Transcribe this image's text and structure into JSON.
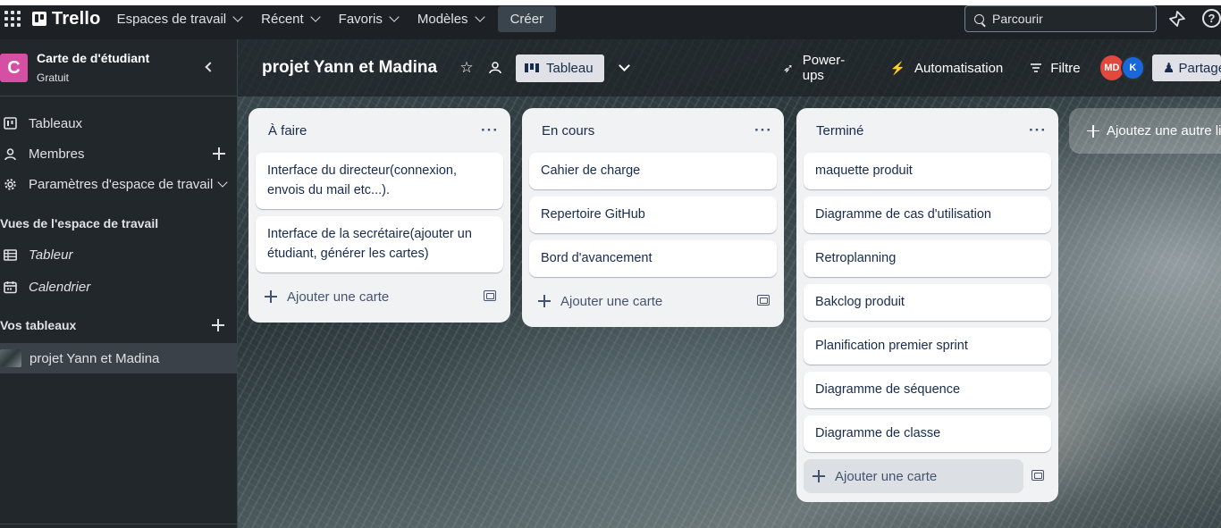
{
  "header": {
    "app_name": "Trello",
    "nav": [
      {
        "label": "Espaces de travail"
      },
      {
        "label": "Récent"
      },
      {
        "label": "Favoris"
      },
      {
        "label": "Modèles"
      }
    ],
    "create_label": "Créer",
    "search_placeholder": "Parcourir"
  },
  "sidebar": {
    "workspace_initial": "C",
    "workspace_name": "Carte de d'étudiant",
    "workspace_plan": "Gratuit",
    "items": [
      {
        "label": "Tableaux"
      },
      {
        "label": "Membres"
      },
      {
        "label": "Paramètres d'espace de travail"
      }
    ],
    "views_title": "Vues de l'espace de travail",
    "views": [
      {
        "label": "Tableur"
      },
      {
        "label": "Calendrier"
      }
    ],
    "boards_title": "Vos tableaux",
    "boards": [
      {
        "label": "projet Yann et Madina"
      }
    ]
  },
  "board": {
    "title": "projet Yann et Madina",
    "view_label": "Tableau",
    "powerups_label": "Power-ups",
    "automation_label": "Automatisation",
    "filter_label": "Filtre",
    "members": [
      {
        "initials": "MD",
        "color": "#e2483d"
      },
      {
        "initials": "K",
        "color": "#1868db"
      }
    ],
    "share_label": "Partager",
    "add_list_label": "Ajoutez une autre liste",
    "add_card_label": "Ajouter une carte",
    "lists": [
      {
        "title": "À faire",
        "cards": [
          "Interface du directeur(connexion, envois du mail etc...).",
          "Interface de la secrétaire(ajouter un étudiant, générer les cartes)"
        ]
      },
      {
        "title": "En cours",
        "cards": [
          "Cahier de charge",
          "Repertoire GitHub",
          "Bord d'avancement"
        ]
      },
      {
        "title": "Terminé",
        "cards": [
          "maquette produit",
          "Diagramme de cas d'utilisation",
          "Retroplanning",
          "Bakclog produit",
          "Planification premier sprint",
          "Diagramme de séquence",
          "Diagramme de classe"
        ]
      }
    ]
  },
  "colors": {
    "header_bg": "#1d2125",
    "sidebar_bg": "#22272b",
    "workspace_badge": "#d54fa3",
    "list_bg": "#f1f2f4",
    "card_bg": "#ffffff",
    "card_text": "#172b4d"
  }
}
